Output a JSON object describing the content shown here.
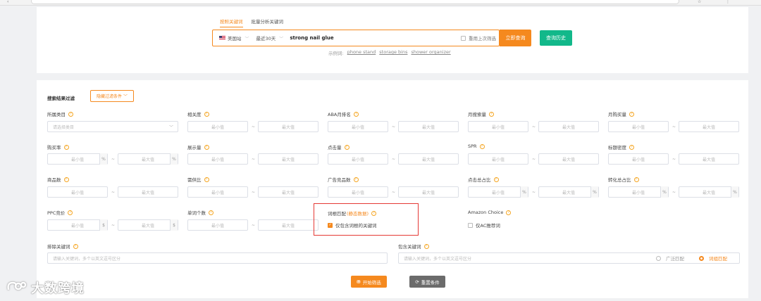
{
  "search": {
    "tabs": [
      "按照关键词",
      "批量分析关键词"
    ],
    "site": "美国站",
    "period": "最近30天",
    "keyword": "strong nail glue",
    "reuse_label": "重用上次筛选",
    "submit": "立即查询",
    "history": "查询历史",
    "examples_label": "示例词:",
    "examples": [
      "phone stand",
      "storage bins",
      "shower organizer"
    ]
  },
  "filters": {
    "title": "搜索结果过滤",
    "hide_button": "隐藏过滤条件",
    "min": "最小值",
    "max": "最大值",
    "dash": "~",
    "category_label": "所属类目",
    "category_placeholder": "请选择类目",
    "row1": [
      "相关度",
      "ABA月排名",
      "月搜索量",
      "月购买量"
    ],
    "row2": [
      "购买率",
      "展示量",
      "点击量",
      "SPR",
      "标题密度"
    ],
    "row3": [
      "商品数",
      "需供比",
      "广告竞品数",
      "点击总占比",
      "转化总占比"
    ],
    "row4": [
      "PPC竞价",
      "单词个数"
    ],
    "percent_unit": "%",
    "dollar_unit": "$",
    "phrase_match": {
      "label": "词根匹配",
      "tag": "(静态数据)",
      "option": "仅包含词根的关键词"
    },
    "amazon_choice": {
      "label": "Amazon Choice",
      "option": "仅AC推荐词"
    },
    "exclude": {
      "label": "排除关键词",
      "placeholder": "请输入关键词，多个以英文逗号区分"
    },
    "include": {
      "label": "包含关键词",
      "placeholder": "请输入关键词，多个以英文逗号区分",
      "broad": "广泛匹配",
      "phrase": "词组匹配"
    },
    "start": "开始筛选",
    "reset": "重置条件"
  },
  "watermark": "大数跨境",
  "colors": {
    "accent": "#f5891e",
    "history": "#12b88a",
    "highlight": "#e53935"
  }
}
